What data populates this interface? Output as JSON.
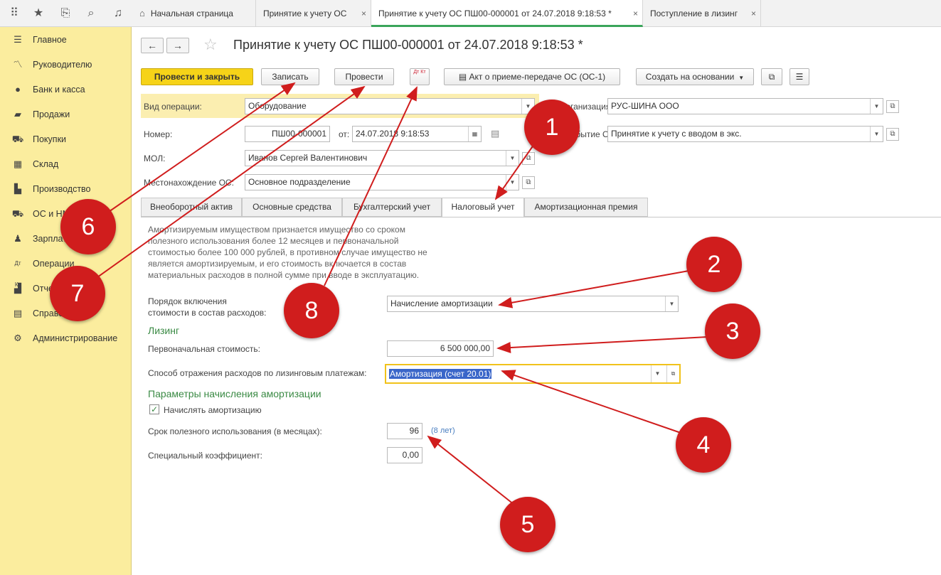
{
  "topbar": {
    "tabs": [
      {
        "label": "Начальная страница"
      },
      {
        "label": "Принятие к учету ОС"
      },
      {
        "label": "Принятие к учету ОС ПШ00-000001 от 24.07.2018 9:18:53 *"
      },
      {
        "label": "Поступление в лизинг"
      }
    ],
    "close_glyph": "×"
  },
  "sidebar": {
    "items": [
      {
        "label": "Главное",
        "icon": "menu-icon"
      },
      {
        "label": "Руководителю",
        "icon": "trend-icon"
      },
      {
        "label": "Банк и касса",
        "icon": "coin-icon"
      },
      {
        "label": "Продажи",
        "icon": "bag-icon"
      },
      {
        "label": "Покупки",
        "icon": "cart-icon"
      },
      {
        "label": "Склад",
        "icon": "grid-icon"
      },
      {
        "label": "Производство",
        "icon": "factory-icon"
      },
      {
        "label": "ОС и НМА",
        "icon": "truck-icon"
      },
      {
        "label": "Зарплата и кадры",
        "icon": "person-icon"
      },
      {
        "label": "Операции",
        "icon": "dtkt-icon"
      },
      {
        "label": "Отчеты",
        "icon": "bar-chart-icon"
      },
      {
        "label": "Справочники",
        "icon": "books-icon"
      },
      {
        "label": "Администрирование",
        "icon": "gear-icon"
      }
    ]
  },
  "doc": {
    "title": "Принятие к учету ОС ПШ00-000001 от 24.07.2018 9:18:53 *",
    "toolbar": {
      "post_close": "Провести и закрыть",
      "save": "Записать",
      "post": "Провести",
      "dtkt": "Дт Кт",
      "act": "Акт о приеме-передаче ОС (ОС-1)",
      "create_based": "Создать на основании"
    },
    "header": {
      "vid_label": "Вид операции:",
      "vid_value": "Оборудование",
      "org_label": "Организация:",
      "org_value": "РУС-ШИНА ООО",
      "nomer_label": "Номер:",
      "nomer_value": "ПШ00-000001",
      "ot_label": "от:",
      "date_value": "24.07.2018  9:18:53",
      "sob_label": "Событие ОС:",
      "sob_value": "Принятие к учету с вводом в экс.",
      "mol_label": "МОЛ:",
      "mol_value": "Иванов Сергей Валентинович",
      "mesto_label": "Местонахождение ОС:",
      "mesto_value": "Основное подразделение"
    },
    "tabs": [
      {
        "label": "Внеоборотный актив"
      },
      {
        "label": "Основные средства"
      },
      {
        "label": "Бухгалтерский учет"
      },
      {
        "label": "Налоговый учет"
      },
      {
        "label": "Амортизационная премия"
      }
    ],
    "tax": {
      "hint": "Амортизируемым имуществом признается имущество со сроком полезного использования более 12 месяцев и первоначальной стоимостью более 100 000 рублей, в противном случае имущество не является амортизируемым, и его стоимость включается в состав материальных расходов в полной сумме при вводе в эксплуатацию.",
      "order_label_1": "Порядок включения",
      "order_label_2": "стоимости в состав расходов:",
      "order_value": "Начисление амортизации",
      "leasing_title": "Лизинг",
      "initial_cost_label": "Первоначальная стоимость:",
      "initial_cost_value": "6 500 000,00",
      "method_label": "Способ отражения расходов по лизинговым платежам:",
      "method_value": "Амортизация (счет 20.01)",
      "amort_title": "Параметры начисления амортизации",
      "accrue_label": "Начислять амортизацию",
      "term_label": "Срок полезного использования (в месяцах):",
      "term_value": "96",
      "term_years": "(8 лет)",
      "coef_label": "Специальный коэффициент:",
      "coef_value": "0,00"
    }
  },
  "annotations": {
    "markers": [
      "1",
      "2",
      "3",
      "4",
      "5",
      "6",
      "7",
      "8"
    ],
    "color": "#d01d1d"
  }
}
